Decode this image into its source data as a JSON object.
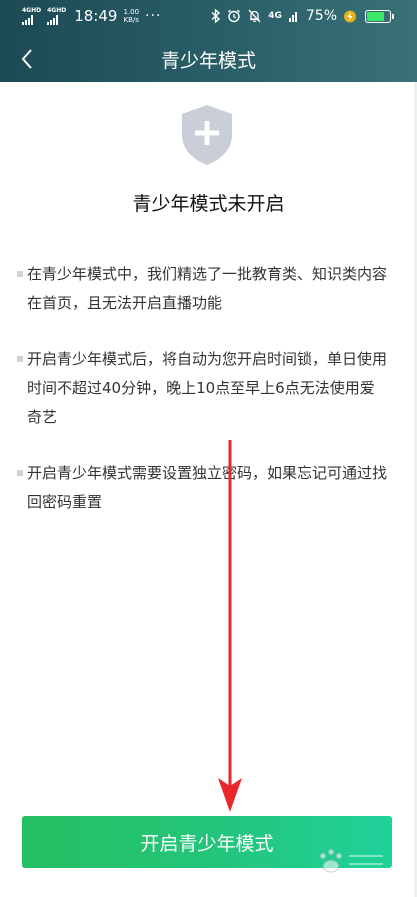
{
  "status_bar": {
    "network_1": "4GHD",
    "network_2": "4GHD",
    "time": "18:49",
    "speed_value": "1.00",
    "speed_unit": "KB/s",
    "overflow_dots": "···",
    "signal_label": "4G",
    "battery_percent": "75%",
    "battery_level": 0.75,
    "battery_fill_color": "#3ee86b"
  },
  "header": {
    "back_icon": "chevron-left-icon",
    "title": "青少年模式"
  },
  "main": {
    "shield_icon": "shield-plus-icon",
    "heading": "青少年模式未开启",
    "bullets": [
      "在青少年模式中，我们精选了一批教育类、知识类内容在首页，且无法开启直播功能",
      "开启青少年模式后，将自动为您开启时间锁，单日使用时间不超过40分钟，晚上10点至早上6点无法使用爱奇艺",
      "开启青少年模式需要设置独立密码，如果忘记可通过找回密码重置"
    ]
  },
  "cta": {
    "label": "开启青少年模式"
  },
  "overlay": {
    "arrow_icon": "red-down-arrow-icon",
    "watermark_icon": "baidu-jingyan-watermark-icon"
  },
  "colors": {
    "header_start": "#1c4a55",
    "header_end": "#3a7178",
    "cta_start": "#25c061",
    "cta_end": "#1fd29a",
    "arrow": "#e8272a"
  }
}
